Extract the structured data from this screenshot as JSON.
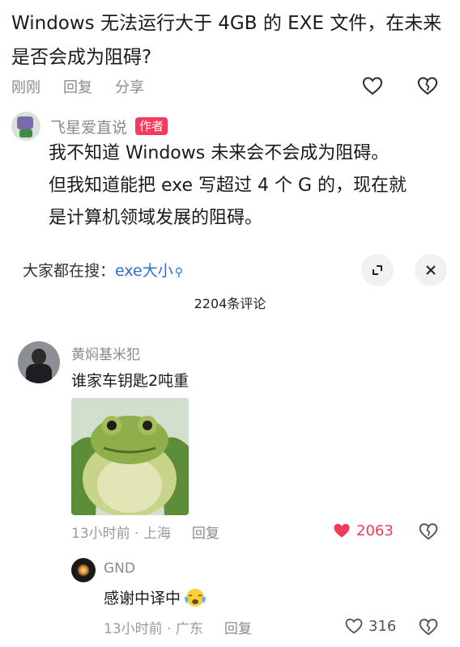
{
  "question": {
    "text": "Windows 无法运行大于 4GB 的 EXE 文件，在未来是否会成为阻碍?",
    "time": "刚刚",
    "reply_label": "回复",
    "share_label": "分享"
  },
  "author_answer": {
    "name": "飞星爱直说",
    "badge": "作者",
    "lines": [
      "我不知道 Windows 未来会不会成为阻碍。",
      "但我知道能把 exe 写超过 4 个 G 的，现在就",
      "是计算机领域发展的阻碍。"
    ]
  },
  "search": {
    "prefix": "大家都在搜：",
    "term": "exe大小"
  },
  "comments_count": "2204条评论",
  "comment": {
    "user": "黄焖基米犯",
    "text": "谁家车钥匙2吨重",
    "time_location": "13小时前 · 上海",
    "reply_label": "回复",
    "likes": "2063"
  },
  "reply": {
    "user": "GND",
    "text": "感谢中译中",
    "time_location": "13小时前 · 广东",
    "reply_label": "回复",
    "likes": "316"
  },
  "colors": {
    "accent_red": "#f23b5c",
    "link_blue": "#2f6dd6",
    "muted_text": "#8a8a8a"
  },
  "icons": [
    "heart-outline-icon",
    "broken-heart-icon",
    "collapse-icon",
    "close-icon",
    "search-icon",
    "heart-filled-icon",
    "tears-emoji-icon"
  ]
}
